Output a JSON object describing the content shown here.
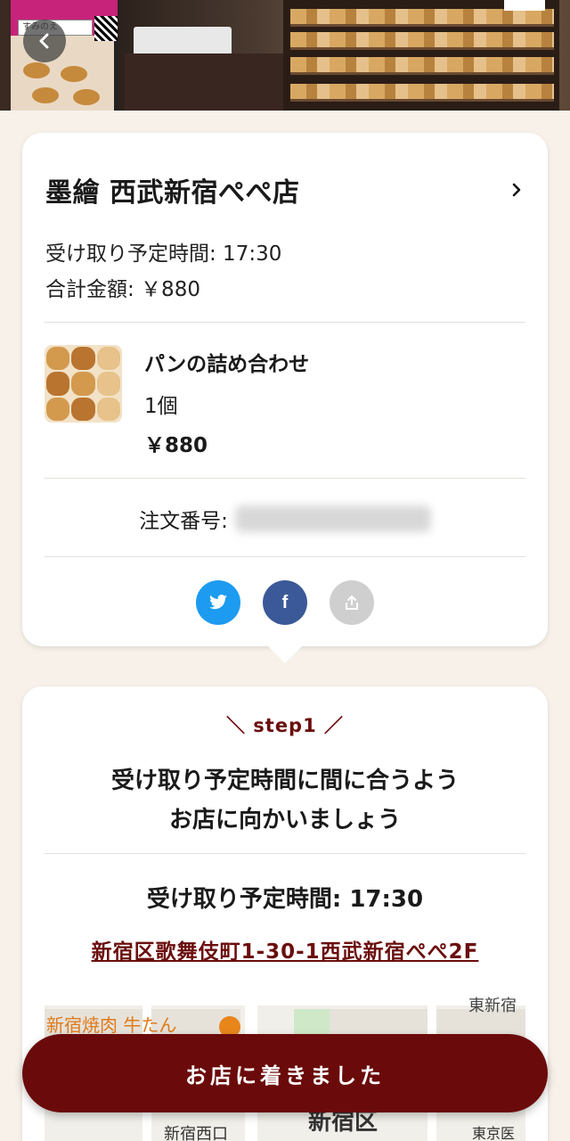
{
  "store": {
    "name": "墨繪 西武新宿ぺぺ店",
    "pickup_time_line": "受け取り予定時間: 17:30",
    "total_line": "合計金額: ￥880"
  },
  "item": {
    "name": "パンの詰め合わせ",
    "quantity": "1個",
    "price": "￥880"
  },
  "order": {
    "label": "注文番号:"
  },
  "share": {
    "twitter_icon": "twitter-icon",
    "facebook_icon": "facebook-icon",
    "facebook_glyph": "f",
    "share_icon": "share-icon"
  },
  "step": {
    "label": "＼ step1 ／",
    "headline_line1": "受け取り予定時間に間に合うよう",
    "headline_line2": "お店に向かいましょう",
    "pickup_time": "受け取り予定時間: 17:30",
    "address": "新宿区歌舞伎町1-30-1西武新宿ぺぺ2F"
  },
  "map": {
    "labels": {
      "yakiniku": "新宿焼肉 牛たん",
      "higashi_shinjuku": "東新宿",
      "shinjuku_ku": "新宿区",
      "nishiguchi": "新宿西口",
      "tokyo": "東京医"
    }
  },
  "hero": {
    "sign_text": "すみのえ"
  },
  "actions": {
    "arrived": "お店に着きました"
  },
  "colors": {
    "accent": "#6b0a0a",
    "background": "#f7f1ea",
    "twitter": "#1d9bf0",
    "facebook": "#3b5998"
  }
}
